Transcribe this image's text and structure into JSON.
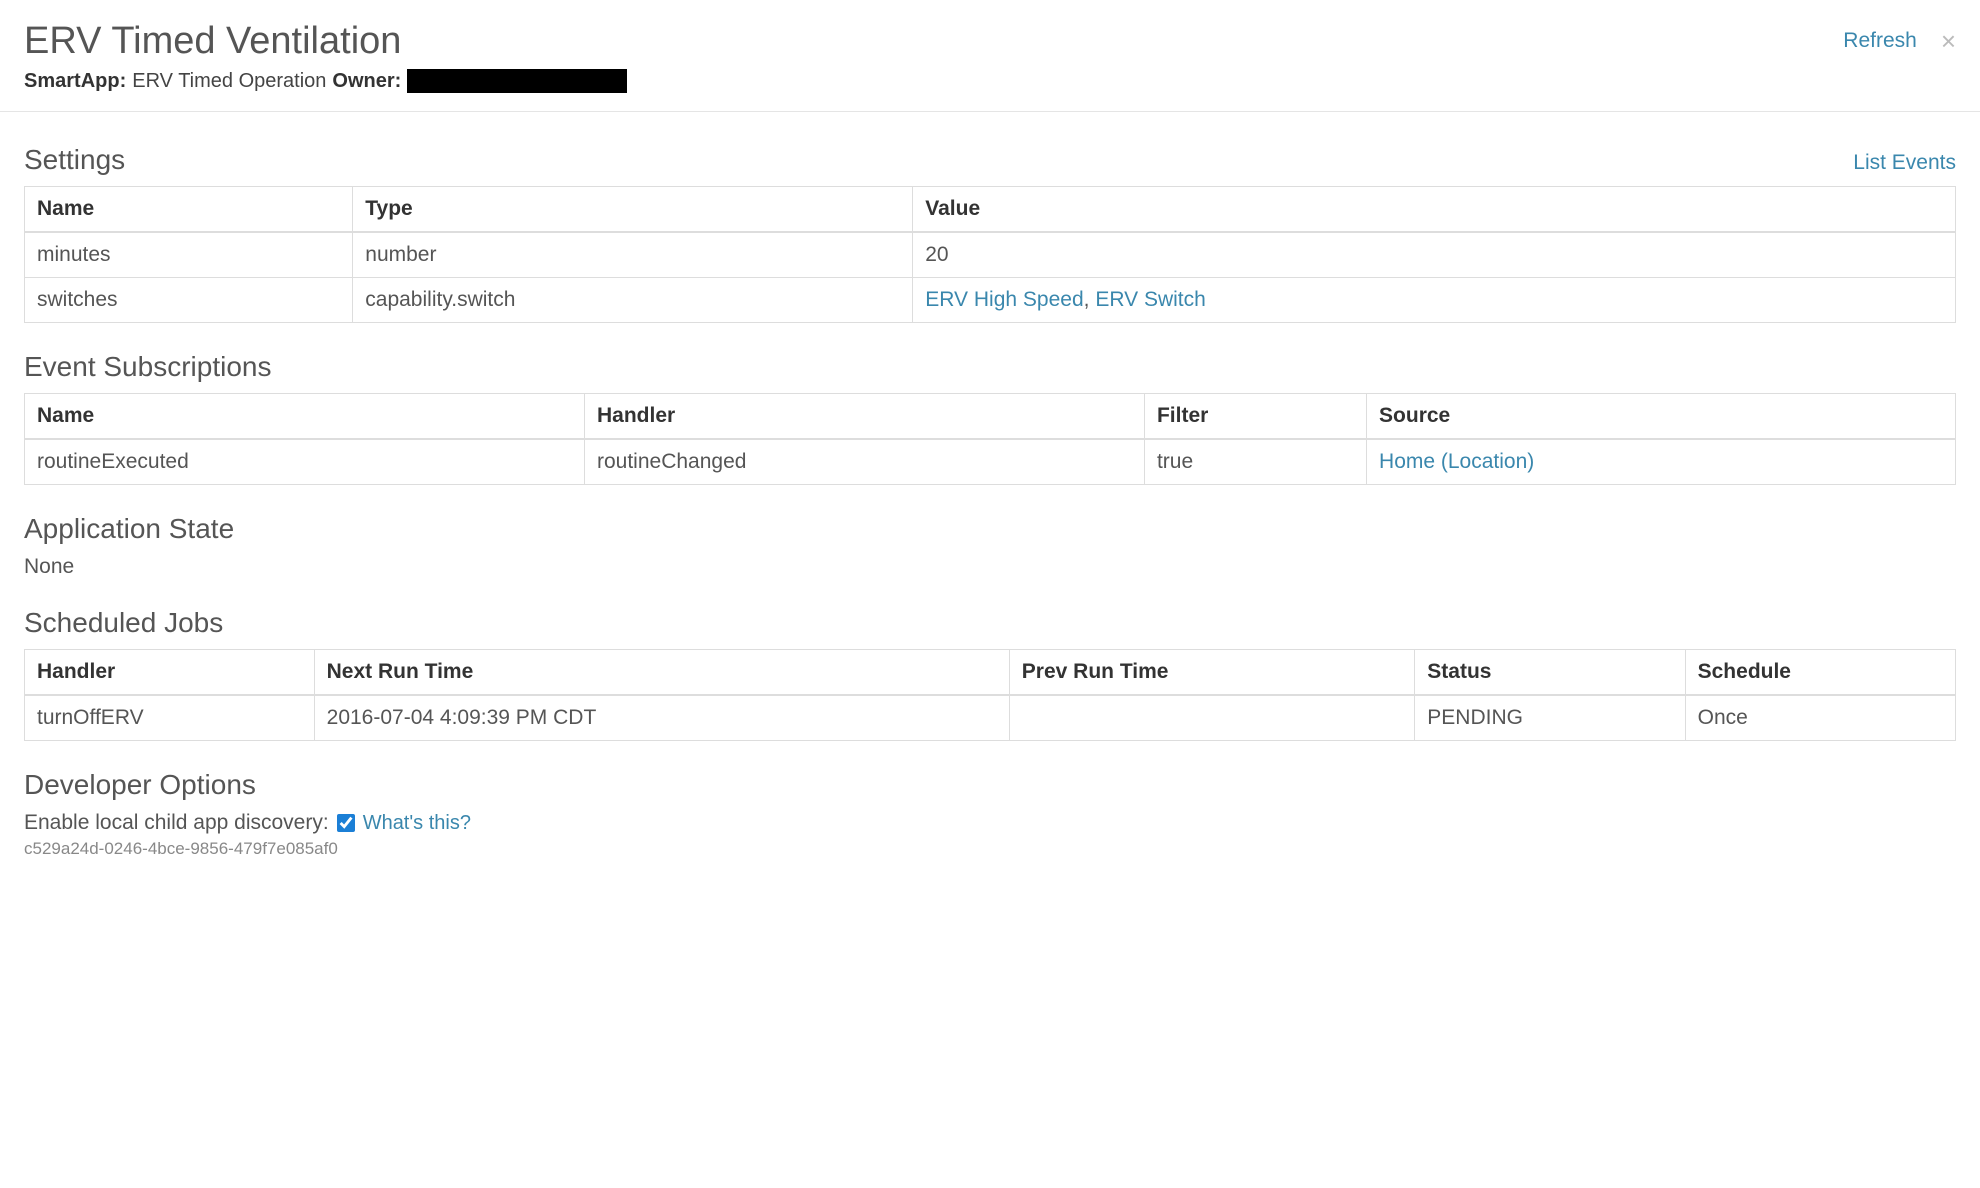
{
  "header": {
    "title": "ERV Timed Ventilation",
    "smartapp_label": "SmartApp:",
    "smartapp_value": "ERV Timed Operation",
    "owner_label": "Owner:",
    "refresh": "Refresh"
  },
  "settings": {
    "heading": "Settings",
    "list_events": "List Events",
    "columns": {
      "name": "Name",
      "type": "Type",
      "value": "Value"
    },
    "rows": [
      {
        "name": "minutes",
        "type": "number",
        "value": "20",
        "is_link": false
      },
      {
        "name": "switches",
        "type": "capability.switch",
        "value_links": [
          "ERV High Speed",
          "ERV Switch"
        ],
        "is_link": true
      }
    ]
  },
  "subscriptions": {
    "heading": "Event Subscriptions",
    "columns": {
      "name": "Name",
      "handler": "Handler",
      "filter": "Filter",
      "source": "Source"
    },
    "rows": [
      {
        "name": "routineExecuted",
        "handler": "routineChanged",
        "filter": "true",
        "source": "Home (Location)"
      }
    ]
  },
  "app_state": {
    "heading": "Application State",
    "value": "None"
  },
  "jobs": {
    "heading": "Scheduled Jobs",
    "columns": {
      "handler": "Handler",
      "next": "Next Run Time",
      "prev": "Prev Run Time",
      "status": "Status",
      "schedule": "Schedule"
    },
    "rows": [
      {
        "handler": "turnOffERV",
        "next": "2016-07-04 4:09:39 PM CDT",
        "prev": "",
        "status": "PENDING",
        "schedule": "Once"
      }
    ]
  },
  "dev": {
    "heading": "Developer Options",
    "enable_label": "Enable local child app discovery:",
    "whats_this": "What's this?",
    "uuid": "c529a24d-0246-4bce-9856-479f7e085af0"
  }
}
